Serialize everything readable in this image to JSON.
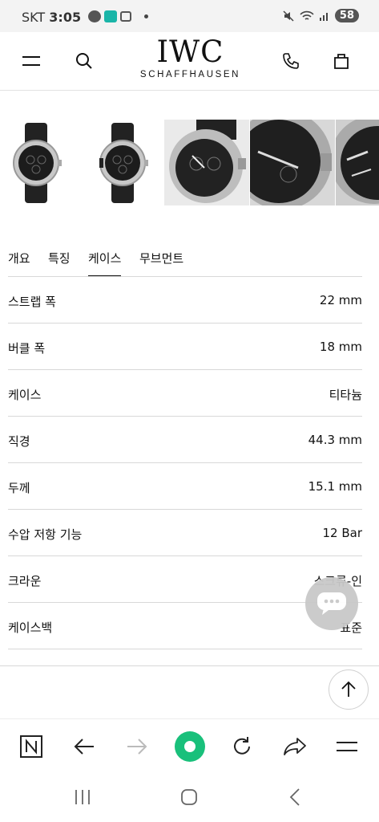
{
  "status_bar": {
    "carrier": "SKT",
    "time": "3:05",
    "battery": "58"
  },
  "header": {
    "logo_main": "IWC",
    "logo_sub": "SCHAFFHAUSEN"
  },
  "gallery": {
    "images": [
      "watch-front-1",
      "watch-front-2",
      "watch-closeup-1",
      "watch-closeup-2",
      "watch-closeup-3"
    ]
  },
  "tabs": [
    {
      "label": "개요",
      "active": false
    },
    {
      "label": "특징",
      "active": false
    },
    {
      "label": "케이스",
      "active": true
    },
    {
      "label": "무브먼트",
      "active": false
    }
  ],
  "specs": [
    {
      "label": "스트랩 폭",
      "value": "22 mm"
    },
    {
      "label": "버클 폭",
      "value": "18 mm"
    },
    {
      "label": "케이스",
      "value": "티타늄"
    },
    {
      "label": "직경",
      "value": "44.3 mm"
    },
    {
      "label": "두께",
      "value": "15.1 mm"
    },
    {
      "label": "수압 저항 기능",
      "value": "12 Bar"
    },
    {
      "label": "크라운",
      "value": "스크류-인"
    },
    {
      "label": "케이스백",
      "value": "표준"
    }
  ],
  "colors": {
    "accent_green": "#19c07b",
    "chat_bg": "#c9c9c9",
    "divider": "#d8d8d8"
  }
}
